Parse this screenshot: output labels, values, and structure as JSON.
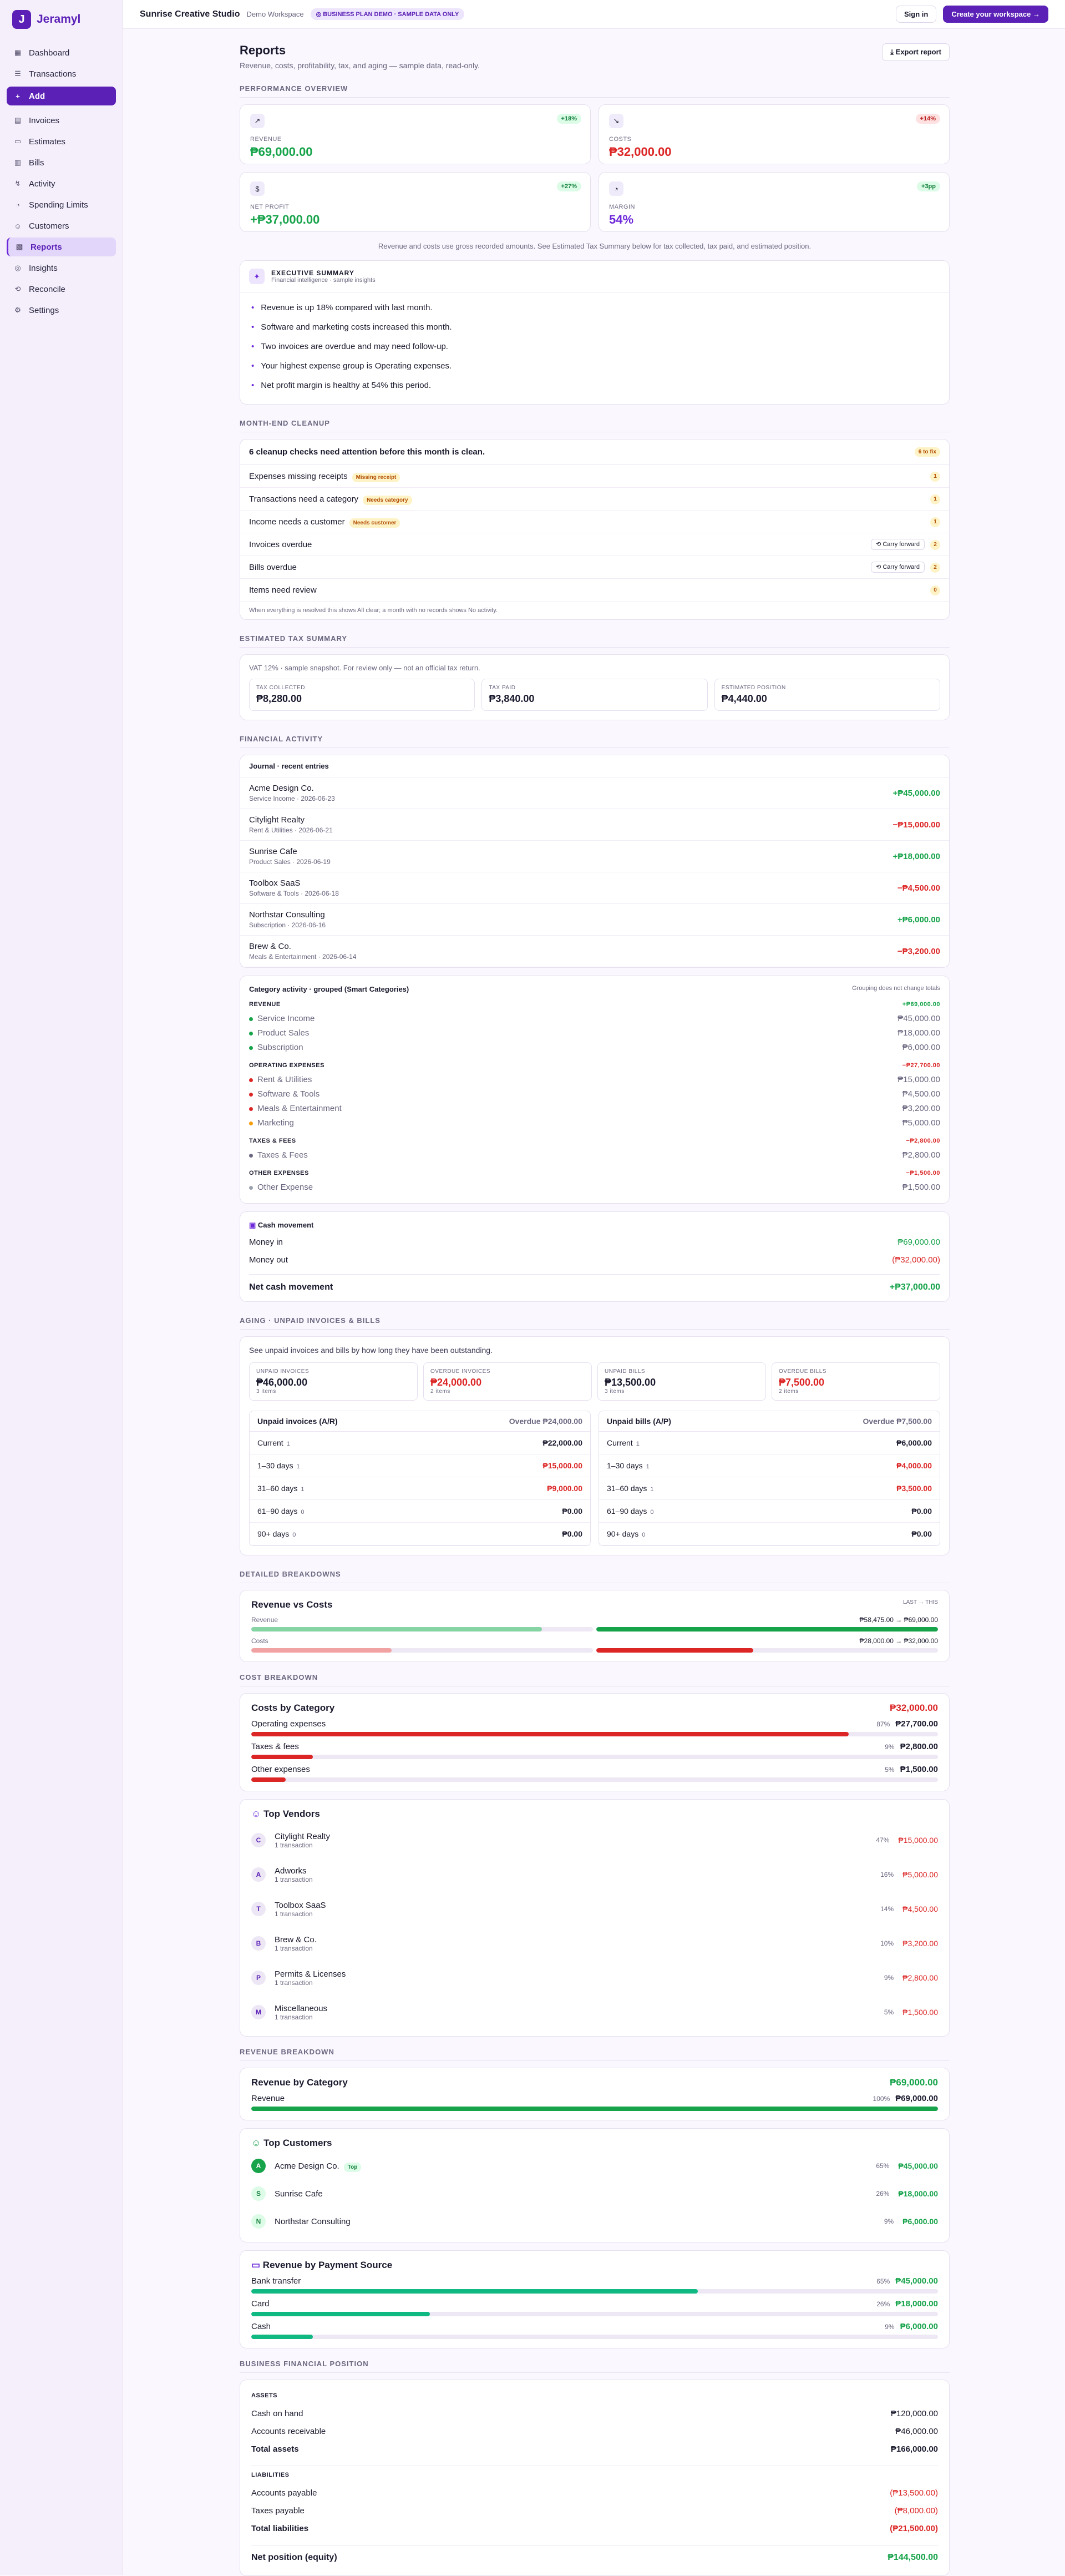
{
  "app": {
    "name": "Jeramyl",
    "logo_letter": "J"
  },
  "nav": [
    {
      "label": "Dashboard",
      "icon": "▦"
    },
    {
      "label": "Transactions",
      "icon": "☰"
    },
    {
      "label": "Add",
      "icon": "+"
    },
    {
      "label": "Invoices",
      "icon": "▤"
    },
    {
      "label": "Estimates",
      "icon": "▭"
    },
    {
      "label": "Bills",
      "icon": "▥"
    },
    {
      "label": "Activity",
      "icon": "↯"
    },
    {
      "label": "Spending Limits",
      "icon": "◔"
    },
    {
      "label": "Customers",
      "icon": "☺"
    },
    {
      "label": "Reports",
      "icon": "▧"
    },
    {
      "label": "Insights",
      "icon": "◎"
    },
    {
      "label": "Reconcile",
      "icon": "⟲"
    },
    {
      "label": "Settings",
      "icon": "⚙"
    }
  ],
  "topbar": {
    "workspace": "Sunrise Creative Studio",
    "sub": "Demo Workspace",
    "badge": "◎ BUSINESS PLAN DEMO · SAMPLE DATA ONLY",
    "signin": "Sign in",
    "create": "Create your workspace →"
  },
  "header": {
    "title": "Reports",
    "subtitle": "Revenue, costs, profitability, tax, and aging — sample data, read-only.",
    "export": "⤓ Export report"
  },
  "sections": {
    "perf": "Performance overview",
    "cleanup": "Month-end cleanup",
    "tax": "Estimated tax summary",
    "fin": "Financial activity",
    "aging": "Aging · unpaid invoices & bills",
    "detail": "Detailed breakdowns",
    "cost": "Cost breakdown",
    "rev": "Revenue breakdown",
    "pos": "Business financial position"
  },
  "kpis": [
    {
      "icon": "↗",
      "badge": "+18%",
      "label": "REVENUE",
      "value": "₱69,000.00",
      "color": "g"
    },
    {
      "icon": "↘",
      "badge": "+14%",
      "label": "COSTS",
      "value": "₱32,000.00",
      "color": "r"
    },
    {
      "icon": "$",
      "badge": "+27%",
      "label": "NET PROFIT",
      "value": "+₱37,000.00",
      "color": "g"
    },
    {
      "icon": "◔",
      "badge": "+3pp",
      "label": "MARGIN",
      "value": "54%",
      "color": "p"
    }
  ],
  "note": "Revenue and costs use gross recorded amounts. See Estimated Tax Summary below for tax collected, tax paid, and estimated position.",
  "exec": {
    "title": "EXECUTIVE SUMMARY",
    "sub": "Financial intelligence · sample insights",
    "items": [
      "Revenue is up 18% compared with last month.",
      "Software and marketing costs increased this month.",
      "Two invoices are overdue and may need follow-up.",
      "Your highest expense group is Operating expenses.",
      "Net profit margin is healthy at 54% this period."
    ]
  },
  "cleanup": {
    "head": "6 cleanup checks need attention before this month is clean.",
    "head_badge": "6 to fix",
    "carry": "⟲ Carry forward",
    "rows": [
      {
        "label": "Expenses missing receipts",
        "pill": "Missing receipt",
        "count": "1",
        "carry": false
      },
      {
        "label": "Transactions need a category",
        "pill": "Needs category",
        "count": "1",
        "carry": false
      },
      {
        "label": "Income needs a customer",
        "pill": "Needs customer",
        "count": "1",
        "carry": false
      },
      {
        "label": "Invoices overdue",
        "pill": "",
        "count": "2",
        "carry": true
      },
      {
        "label": "Bills overdue",
        "pill": "",
        "count": "2",
        "carry": true
      },
      {
        "label": "Items need review",
        "pill": "",
        "count": "0",
        "carry": false
      }
    ],
    "foot": "When everything is resolved this shows All clear; a month with no records shows No activity."
  },
  "tax": {
    "note": "VAT 12% · sample snapshot. For review only — not an official tax return.",
    "boxes": [
      {
        "l": "TAX COLLECTED",
        "v": "₱8,280.00"
      },
      {
        "l": "TAX PAID",
        "v": "₱3,840.00"
      },
      {
        "l": "ESTIMATED POSITION",
        "v": "₱4,440.00"
      }
    ]
  },
  "journal": {
    "title": "Journal · recent entries",
    "rows": [
      {
        "n": "Acme Design Co.",
        "d": "Service Income · 2026-06-23",
        "a": "+₱45,000.00",
        "c": "g"
      },
      {
        "n": "Citylight Realty",
        "d": "Rent & Utilities · 2026-06-21",
        "a": "−₱15,000.00",
        "c": "r"
      },
      {
        "n": "Sunrise Cafe",
        "d": "Product Sales · 2026-06-19",
        "a": "+₱18,000.00",
        "c": "g"
      },
      {
        "n": "Toolbox SaaS",
        "d": "Software & Tools · 2026-06-18",
        "a": "−₱4,500.00",
        "c": "r"
      },
      {
        "n": "Northstar Consulting",
        "d": "Subscription · 2026-06-16",
        "a": "+₱6,000.00",
        "c": "g"
      },
      {
        "n": "Brew & Co.",
        "d": "Meals & Entertainment · 2026-06-14",
        "a": "−₱3,200.00",
        "c": "r"
      }
    ]
  },
  "category": {
    "title": "Category activity · grouped (Smart Categories)",
    "right": "Grouping does not change totals",
    "groups": [
      {
        "name": "REVENUE",
        "total": "+₱69,000.00",
        "c": "g",
        "items": [
          {
            "n": "Service Income",
            "v": "₱45,000.00",
            "dot": "#16a34a"
          },
          {
            "n": "Product Sales",
            "v": "₱18,000.00",
            "dot": "#16a34a"
          },
          {
            "n": "Subscription",
            "v": "₱6,000.00",
            "dot": "#16a34a"
          }
        ]
      },
      {
        "name": "OPERATING EXPENSES",
        "total": "−₱27,700.00",
        "c": "r",
        "items": [
          {
            "n": "Rent & Utilities",
            "v": "₱15,000.00",
            "dot": "#dc2626"
          },
          {
            "n": "Software & Tools",
            "v": "₱4,500.00",
            "dot": "#dc2626"
          },
          {
            "n": "Meals & Entertainment",
            "v": "₱3,200.00",
            "dot": "#dc2626"
          },
          {
            "n": "Marketing",
            "v": "₱5,000.00",
            "dot": "#f59e0b"
          }
        ]
      },
      {
        "name": "TAXES & FEES",
        "total": "−₱2,800.00",
        "c": "r",
        "items": [
          {
            "n": "Taxes & Fees",
            "v": "₱2,800.00",
            "dot": "#6b6780"
          }
        ]
      },
      {
        "name": "OTHER EXPENSES",
        "total": "−₱1,500.00",
        "c": "r",
        "items": [
          {
            "n": "Other Expense",
            "v": "₱1,500.00",
            "dot": "#9ca3af"
          }
        ]
      }
    ]
  },
  "cash": {
    "title": "Cash movement",
    "in_l": "Money in",
    "in_v": "₱69,000.00",
    "out_l": "Money out",
    "out_v": "(₱32,000.00)",
    "net_l": "Net cash movement",
    "net_v": "+₱37,000.00"
  },
  "aging": {
    "note": "See unpaid invoices and bills by how long they have been outstanding.",
    "boxes": [
      {
        "l": "UNPAID INVOICES",
        "v": "₱46,000.00",
        "s": "3 items",
        "c": ""
      },
      {
        "l": "OVERDUE INVOICES",
        "v": "₱24,000.00",
        "s": "2 items",
        "c": "r"
      },
      {
        "l": "UNPAID BILLS",
        "v": "₱13,500.00",
        "s": "3 items",
        "c": ""
      },
      {
        "l": "OVERDUE BILLS",
        "v": "₱7,500.00",
        "s": "2 items",
        "c": "r"
      }
    ],
    "ar": {
      "title": "Unpaid invoices (A/R)",
      "overdue": "Overdue ₱24,000.00",
      "rows": [
        {
          "b": "Current",
          "n": "1",
          "v": "₱22,000.00",
          "c": ""
        },
        {
          "b": "1–30 days",
          "n": "1",
          "v": "₱15,000.00",
          "c": "r"
        },
        {
          "b": "31–60 days",
          "n": "1",
          "v": "₱9,000.00",
          "c": "r"
        },
        {
          "b": "61–90 days",
          "n": "0",
          "v": "₱0.00",
          "c": ""
        },
        {
          "b": "90+ days",
          "n": "0",
          "v": "₱0.00",
          "c": ""
        }
      ]
    },
    "ap": {
      "title": "Unpaid bills (A/P)",
      "overdue": "Overdue ₱7,500.00",
      "rows": [
        {
          "b": "Current",
          "n": "1",
          "v": "₱6,000.00",
          "c": ""
        },
        {
          "b": "1–30 days",
          "n": "1",
          "v": "₱4,000.00",
          "c": "r"
        },
        {
          "b": "31–60 days",
          "n": "1",
          "v": "₱3,500.00",
          "c": "r"
        },
        {
          "b": "61–90 days",
          "n": "0",
          "v": "₱0.00",
          "c": ""
        },
        {
          "b": "90+ days",
          "n": "0",
          "v": "₱0.00",
          "c": ""
        }
      ]
    }
  },
  "rvc": {
    "title": "Revenue vs Costs",
    "legend": "LAST → THIS",
    "rows": [
      {
        "l": "Revenue",
        "v": "₱58,475.00 → ₱69,000.00",
        "last": 0.85,
        "this": 1.0,
        "c": "#16a34a",
        "lc": "#86d3a4"
      },
      {
        "l": "Costs",
        "v": "₱28,000.00 → ₱32,000.00",
        "last": 0.41,
        "this": 0.46,
        "c": "#dc2626",
        "lc": "#f1a3a3"
      }
    ]
  },
  "costs": {
    "title": "Costs by Category",
    "total": "₱32,000.00",
    "rows": [
      {
        "l": "Operating expenses",
        "pct": "87%",
        "v": "₱27,700.00",
        "f": 0.87
      },
      {
        "l": "Taxes & fees",
        "pct": "9%",
        "v": "₱2,800.00",
        "f": 0.09
      },
      {
        "l": "Other expenses",
        "pct": "5%",
        "v": "₱1,500.00",
        "f": 0.05
      }
    ]
  },
  "vendors": {
    "title": "Top Vendors",
    "rows": [
      {
        "a": "C",
        "n": "Citylight Realty",
        "s": "1 transaction",
        "pct": "47%",
        "v": "₱15,000.00"
      },
      {
        "a": "A",
        "n": "Adworks",
        "s": "1 transaction",
        "pct": "16%",
        "v": "₱5,000.00"
      },
      {
        "a": "T",
        "n": "Toolbox SaaS",
        "s": "1 transaction",
        "pct": "14%",
        "v": "₱4,500.00"
      },
      {
        "a": "B",
        "n": "Brew & Co.",
        "s": "1 transaction",
        "pct": "10%",
        "v": "₱3,200.00"
      },
      {
        "a": "P",
        "n": "Permits & Licenses",
        "s": "1 transaction",
        "pct": "9%",
        "v": "₱2,800.00"
      },
      {
        "a": "M",
        "n": "Miscellaneous",
        "s": "1 transaction",
        "pct": "5%",
        "v": "₱1,500.00"
      }
    ]
  },
  "revcat": {
    "title": "Revenue by Category",
    "total": "₱69,000.00",
    "rows": [
      {
        "l": "Revenue",
        "pct": "100%",
        "v": "₱69,000.00",
        "f": 1.0
      }
    ]
  },
  "customers": {
    "title": "Top Customers",
    "top": "Top",
    "rows": [
      {
        "a": "A",
        "n": "Acme Design Co.",
        "pct": "65%",
        "v": "₱45,000.00"
      },
      {
        "a": "S",
        "n": "Sunrise Cafe",
        "pct": "26%",
        "v": "₱18,000.00"
      },
      {
        "a": "N",
        "n": "Northstar Consulting",
        "pct": "9%",
        "v": "₱6,000.00"
      }
    ]
  },
  "paysrc": {
    "title": "Revenue by Payment Source",
    "rows": [
      {
        "l": "Bank transfer",
        "pct": "65%",
        "v": "₱45,000.00",
        "f": 0.65
      },
      {
        "l": "Card",
        "pct": "26%",
        "v": "₱18,000.00",
        "f": 0.26
      },
      {
        "l": "Cash",
        "pct": "9%",
        "v": "₱6,000.00",
        "f": 0.09
      }
    ]
  },
  "position": {
    "assets_h": "ASSETS",
    "assets": [
      {
        "l": "Cash on hand",
        "v": "₱120,000.00"
      },
      {
        "l": "Accounts receivable",
        "v": "₱46,000.00"
      }
    ],
    "assets_total_l": "Total assets",
    "assets_total_v": "₱166,000.00",
    "liab_h": "LIABILITIES",
    "liab": [
      {
        "l": "Accounts payable",
        "v": "(₱13,500.00)"
      },
      {
        "l": "Taxes payable",
        "v": "(₱8,000.00)"
      }
    ],
    "liab_total_l": "Total liabilities",
    "liab_total_v": "(₱21,500.00)",
    "net_l": "Net position (equity)",
    "net_v": "₱144,500.00"
  }
}
